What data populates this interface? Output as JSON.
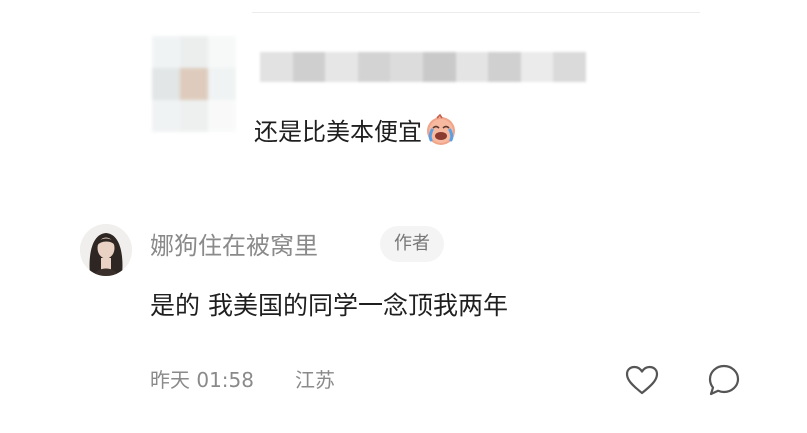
{
  "reply": {
    "text": "还是比美本便宜",
    "emoji": "crying-laughing-emoji"
  },
  "comment": {
    "author_name": "娜狗住在被窝里",
    "author_badge": "作者",
    "text": "是的 我美国的同学一念顶我两年",
    "time": "昨天 01:58",
    "location": "江苏"
  },
  "actions": {
    "like_icon": "heart-outline-icon",
    "comment_icon": "speech-bubble-icon"
  },
  "colors": {
    "primary_text": "#1f1f1f",
    "secondary_text": "#8a8a8a",
    "badge_bg": "#f4f4f4",
    "divider": "#ececec"
  }
}
